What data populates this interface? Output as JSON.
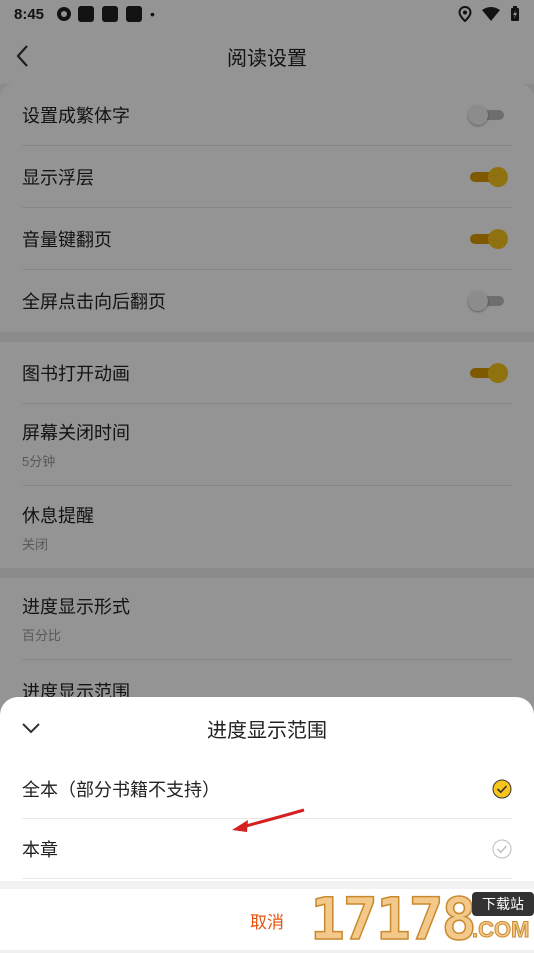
{
  "status_bar": {
    "time": "8:45"
  },
  "header": {
    "title": "阅读设置"
  },
  "settings": {
    "group1": [
      {
        "label": "设置成繁体字",
        "toggle": false
      },
      {
        "label": "显示浮层",
        "toggle": true
      },
      {
        "label": "音量键翻页",
        "toggle": true
      },
      {
        "label": "全屏点击向后翻页",
        "toggle": false
      }
    ],
    "group2": {
      "animation": {
        "label": "图书打开动画",
        "toggle": true
      },
      "screen_off": {
        "label": "屏幕关闭时间",
        "value": "5分钟"
      },
      "rest_reminder": {
        "label": "休息提醒",
        "value": "关闭"
      }
    },
    "group3": {
      "progress_style": {
        "label": "进度显示形式",
        "value": "百分比"
      },
      "progress_range": {
        "label": "进度显示范围"
      }
    }
  },
  "sheet": {
    "title": "进度显示范围",
    "options": [
      {
        "label": "全本（部分书籍不支持）",
        "selected": true
      },
      {
        "label": "本章",
        "selected": false
      }
    ],
    "cancel_label": "取消"
  },
  "watermark": {
    "digits": "17178",
    "badge": "下载站",
    "suffix": ".COM"
  },
  "colors": {
    "accent": "#f7c51b",
    "cancel": "#e8520b",
    "annotation_arrow": "#d42020"
  }
}
